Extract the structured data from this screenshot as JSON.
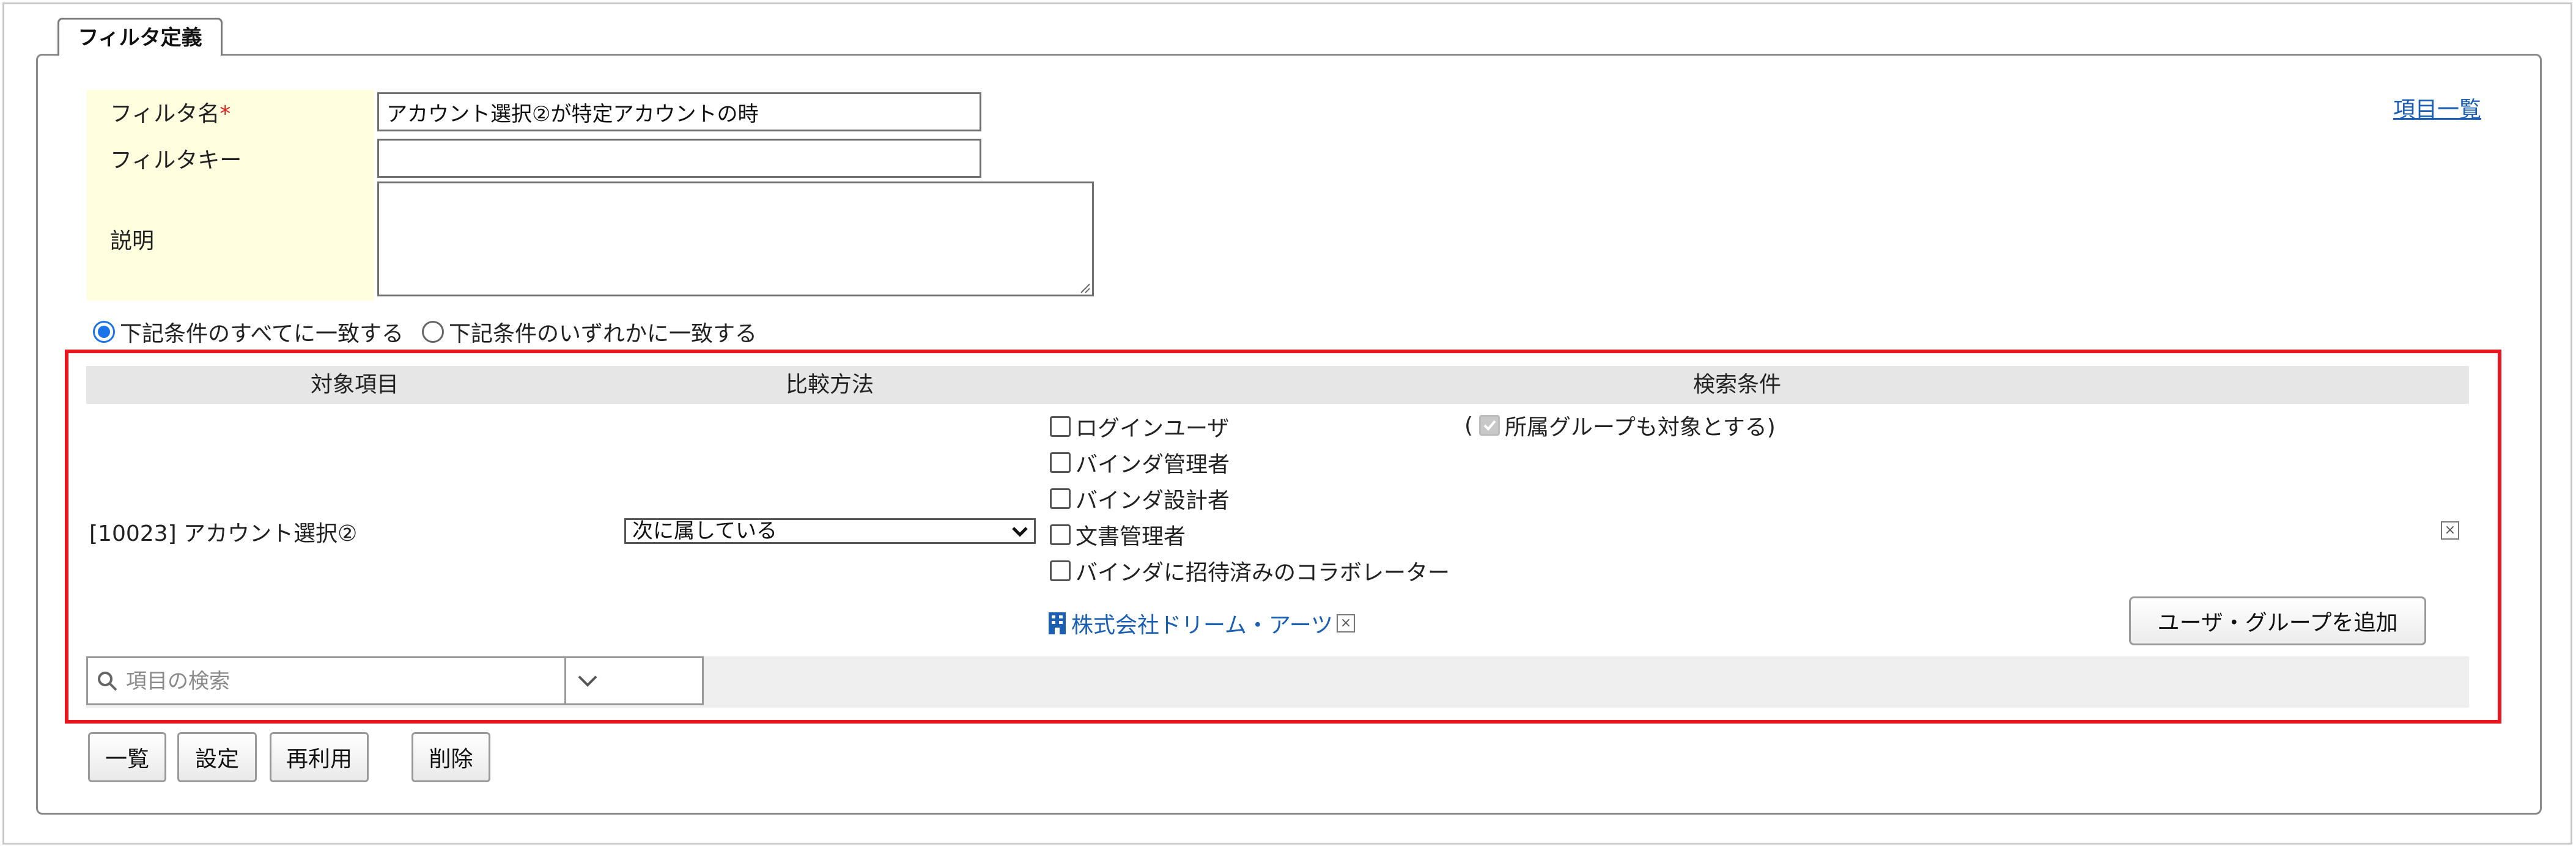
{
  "tab": {
    "label": "フィルタ定義"
  },
  "form": {
    "name_label": "フィルタ名",
    "required_mark": "*",
    "name_value": "アカウント選択②が特定アカウントの時",
    "key_label": "フィルタキー",
    "key_value": "",
    "desc_label": "説明",
    "desc_value": ""
  },
  "item_list_link": "項目一覧",
  "match": {
    "all_label": "下記条件のすべてに一致する",
    "any_label": "下記条件のいずれかに一致する",
    "selected": "all"
  },
  "conditions": {
    "headers": {
      "target": "対象項目",
      "compare": "比較方法",
      "search": "検索条件"
    },
    "row": {
      "target": "[10023]  アカウント選択②",
      "compare_value": "次に属している",
      "user_types": [
        {
          "label": "ログインユーザ",
          "checked": false
        },
        {
          "label": "バインダ管理者",
          "checked": false
        },
        {
          "label": "バインダ設計者",
          "checked": false
        },
        {
          "label": "文書管理者",
          "checked": false
        },
        {
          "label": "バインダに招待済みのコラボレーター",
          "checked": false
        }
      ],
      "group_open": "(",
      "group_label": "所属グループも対象とする)",
      "company_name": "株式会社ドリーム・アーツ",
      "remove_glyph": "×"
    },
    "add_button": "ユーザ・グループを追加",
    "search_placeholder": "項目の検索"
  },
  "buttons": {
    "list": "一覧",
    "settings": "設定",
    "reuse": "再利用",
    "delete": "削除"
  },
  "colors": {
    "highlight": "#e8171f",
    "link": "#1a5fb4",
    "label_bg": "#ffffe0",
    "radio_on": "#1a73e8"
  },
  "icons": [
    "search-icon",
    "chevron-down-icon",
    "building-icon",
    "close-icon",
    "dropdown-arrow-icon",
    "checkbox-check-icon"
  ]
}
